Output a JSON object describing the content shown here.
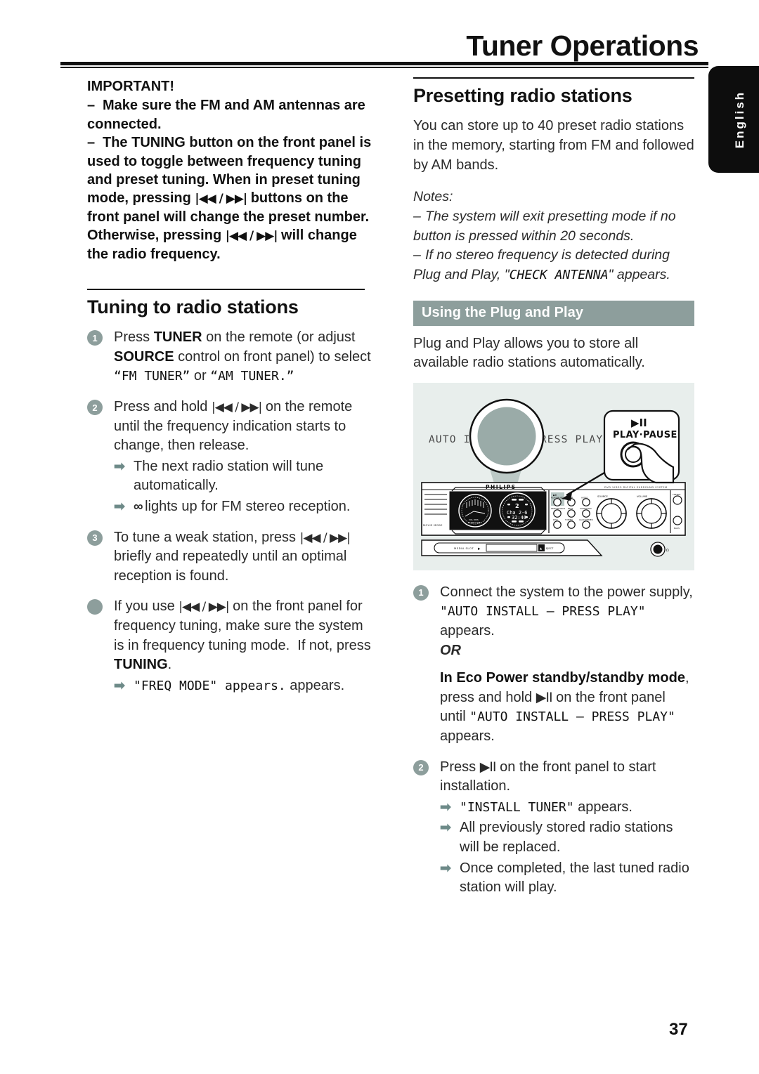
{
  "header": {
    "title": "Tuner Operations",
    "language_tab": "English"
  },
  "page_number": "37",
  "colors": {
    "accent": "#8d9e9c",
    "arrow": "#6d8a88",
    "illustration_bg": "#e8eeec",
    "tab_bg": "#0d0d0d",
    "text": "#2b2b2b"
  },
  "left_column": {
    "important": {
      "title": "IMPORTANT!",
      "items": [
        "Make sure the FM and AM antennas are connected.",
        "The TUNING button on the front panel is used to toggle between frequency tuning and preset tuning. When in preset tuning mode, pressing |<< / >>| buttons on the front panel will change the preset number. Otherwise, pressing |<< / >>| will change the radio frequency."
      ]
    },
    "tuning_section": {
      "heading": "Tuning to radio stations",
      "steps": [
        {
          "marker": "1",
          "text_parts": {
            "p1": "Press ",
            "b1": "TUNER",
            "p2": " on the remote (or adjust ",
            "b2": "SOURCE",
            "p3": " control on front panel) to select ",
            "lcd1": "“FM TUNER”",
            "p4": " or ",
            "lcd2": "“AM TUNER.”"
          }
        },
        {
          "marker": "2",
          "text_parts": {
            "p1": "Press and hold ",
            "glyph": "|◀◀ / ▶▶|",
            "p2": " on the remote until the frequency indication starts to change, then release."
          },
          "subs": [
            "The next radio station will tune automatically.",
            "∞ lights up for FM stereo reception."
          ]
        },
        {
          "marker": "3",
          "text_parts": {
            "p1": "To tune a weak station, press ",
            "glyph": "|◀◀ / ▶▶|",
            "p2": " briefly and repeatedly until an optimal reception is found."
          }
        },
        {
          "marker": "●",
          "text_parts": {
            "p1": "If you use ",
            "glyph": "|◀◀ / ▶▶|",
            "p2": " on the front panel for frequency tuning, make sure the system is in frequency tuning mode.  If not, press ",
            "b1": "TUNING",
            "p3": "."
          },
          "subs": [
            "\"FREQ MODE\" appears."
          ]
        }
      ]
    }
  },
  "right_column": {
    "presetting": {
      "heading": "Presetting radio stations",
      "body": "You can store up to 40 preset radio stations in the memory, starting from FM and followed by AM bands.",
      "notes_label": "Notes:",
      "notes": [
        "The system will exit presetting mode if no button is pressed within 20 seconds.",
        "If no stereo frequency is detected during Plug and Play, \"CHECK ANTENNA\" appears."
      ]
    },
    "plug_and_play": {
      "subhead": "Using the Plug and Play",
      "body": "Plug and Play allows you to store all available radio stations automatically.",
      "illustration": {
        "display_text": "AUTO INSTALL - PRESS PLAY",
        "callout_symbol": "▶II",
        "callout_label": "PLAY·PAUSE",
        "brand": "PHILIPS",
        "model_text": "DVD VIDEO DIGITAL SURROUND SYSTEM",
        "panel_labels": {
          "play_pause": "PLAY•PAUSE",
          "stop": "STOP",
          "audio": "AUDIO",
          "source": "SOURCE",
          "volume": "VOLUME",
          "treble": "TREBLE",
          "bass": "BASS",
          "prev_next": "PREV/NEXT",
          "surround": "SURROUND",
          "tuning": "TUNING",
          "media_slot": "MEDIA SLOT",
          "eject": "EJECT",
          "movie_mode": "MOVIE MODE"
        },
        "lcd_right": {
          "line1": "2",
          "line2": "Cha 2-6",
          "line3": "32:46"
        }
      },
      "steps": [
        {
          "marker": "1",
          "text_parts": {
            "p1": "Connect the system to the power supply, ",
            "lcd1": "\"AUTO INSTALL – PRESS PLAY\"",
            "p2": " appears."
          },
          "or_label": "OR",
          "eco": {
            "bold": "In Eco Power standby/standby mode",
            "p1": ", press and hold ",
            "glyph": "▶II",
            "p2": " on the front panel until ",
            "lcd1": "\"AUTO INSTALL – PRESS PLAY\"",
            "p3": " appears."
          }
        },
        {
          "marker": "2",
          "text_parts": {
            "p1": "Press ",
            "glyph": "▶II",
            "p2": " on the front panel to start installation."
          },
          "subs": [
            "\"INSTALL TUNER\" appears.",
            "All previously stored radio stations will be replaced.",
            "Once completed, the last tuned radio station will play."
          ]
        }
      ]
    }
  }
}
